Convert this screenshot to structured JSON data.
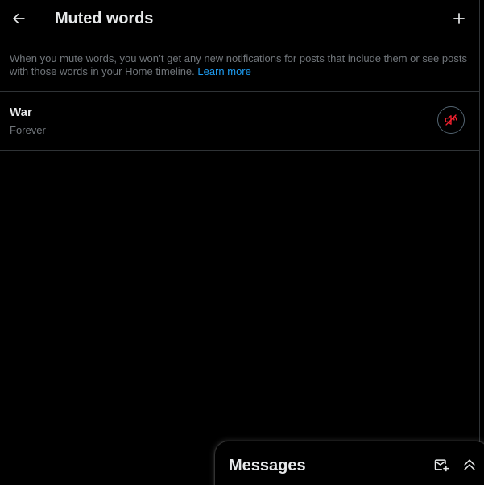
{
  "header": {
    "title": "Muted words",
    "back_icon": "arrow-left-icon",
    "add_icon": "plus-icon"
  },
  "description": {
    "text": "When you mute words, you won’t get any new notifications for posts that include them or see posts with those words in your Home timeline.",
    "link_label": "Learn more"
  },
  "muted_words": [
    {
      "word": "War",
      "duration": "Forever",
      "action_icon": "speaker-muted-icon"
    }
  ],
  "messages_drawer": {
    "title": "Messages",
    "compose_icon": "new-message-icon",
    "expand_icon": "double-chevron-up-icon"
  },
  "colors": {
    "background": "#000000",
    "primary_text": "#e7e9ea",
    "secondary_text": "#71767b",
    "link": "#1d9bf0",
    "divider": "#2f3336",
    "mute_accent": "#f4212e"
  }
}
